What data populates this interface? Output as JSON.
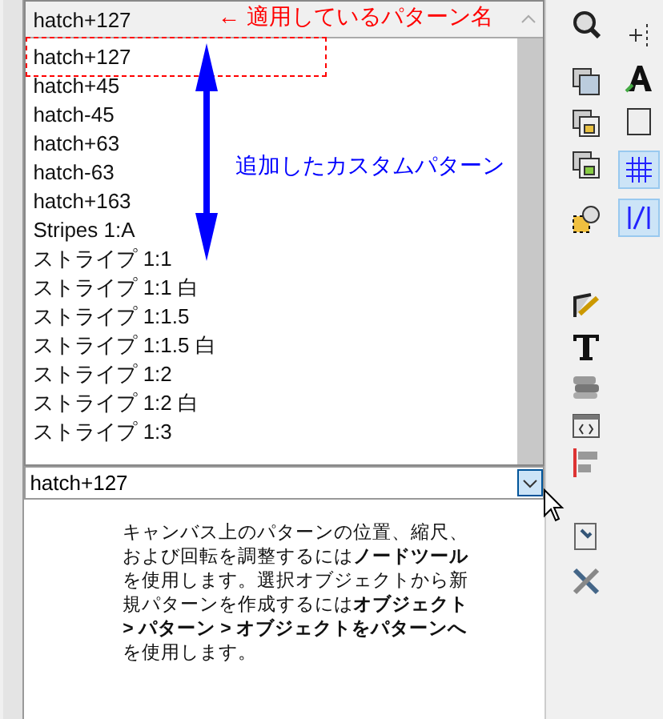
{
  "dropdown_list": {
    "current": "hatch+127",
    "items": [
      {
        "label": "hatch+127"
      },
      {
        "label": "hatch+45"
      },
      {
        "label": "hatch-45"
      },
      {
        "label": "hatch+63"
      },
      {
        "label": "hatch-63"
      },
      {
        "label": "hatch+163"
      },
      {
        "label": "Stripes 1:A"
      },
      {
        "label": "ストライプ 1:1"
      },
      {
        "label": "ストライプ 1:1 白"
      },
      {
        "label": "ストライプ 1:1.5"
      },
      {
        "label": "ストライプ 1:1.5 白"
      },
      {
        "label": "ストライプ 1:2"
      },
      {
        "label": "ストライプ 1:2 白"
      },
      {
        "label": "ストライプ 1:3"
      }
    ]
  },
  "combo": {
    "value": "hatch+127"
  },
  "help_text": "キャンバス上のパターンの位置、縮尺、および回転を調整するには**ノードツール**を使用します。選択オブジェクトから新規パターンを作成するには**オブジェクト > パターン > オブジェクトをパターンへ**を使用します。",
  "annotations": [
    {
      "text": "← 適用しているパターン名",
      "color": "#ff0000"
    },
    {
      "text": "追加したカスタムパターン",
      "color": "#0000ff"
    }
  ],
  "toolbar_right": [
    {
      "selected": false
    },
    {
      "selected": true
    },
    {
      "selected": true
    }
  ]
}
